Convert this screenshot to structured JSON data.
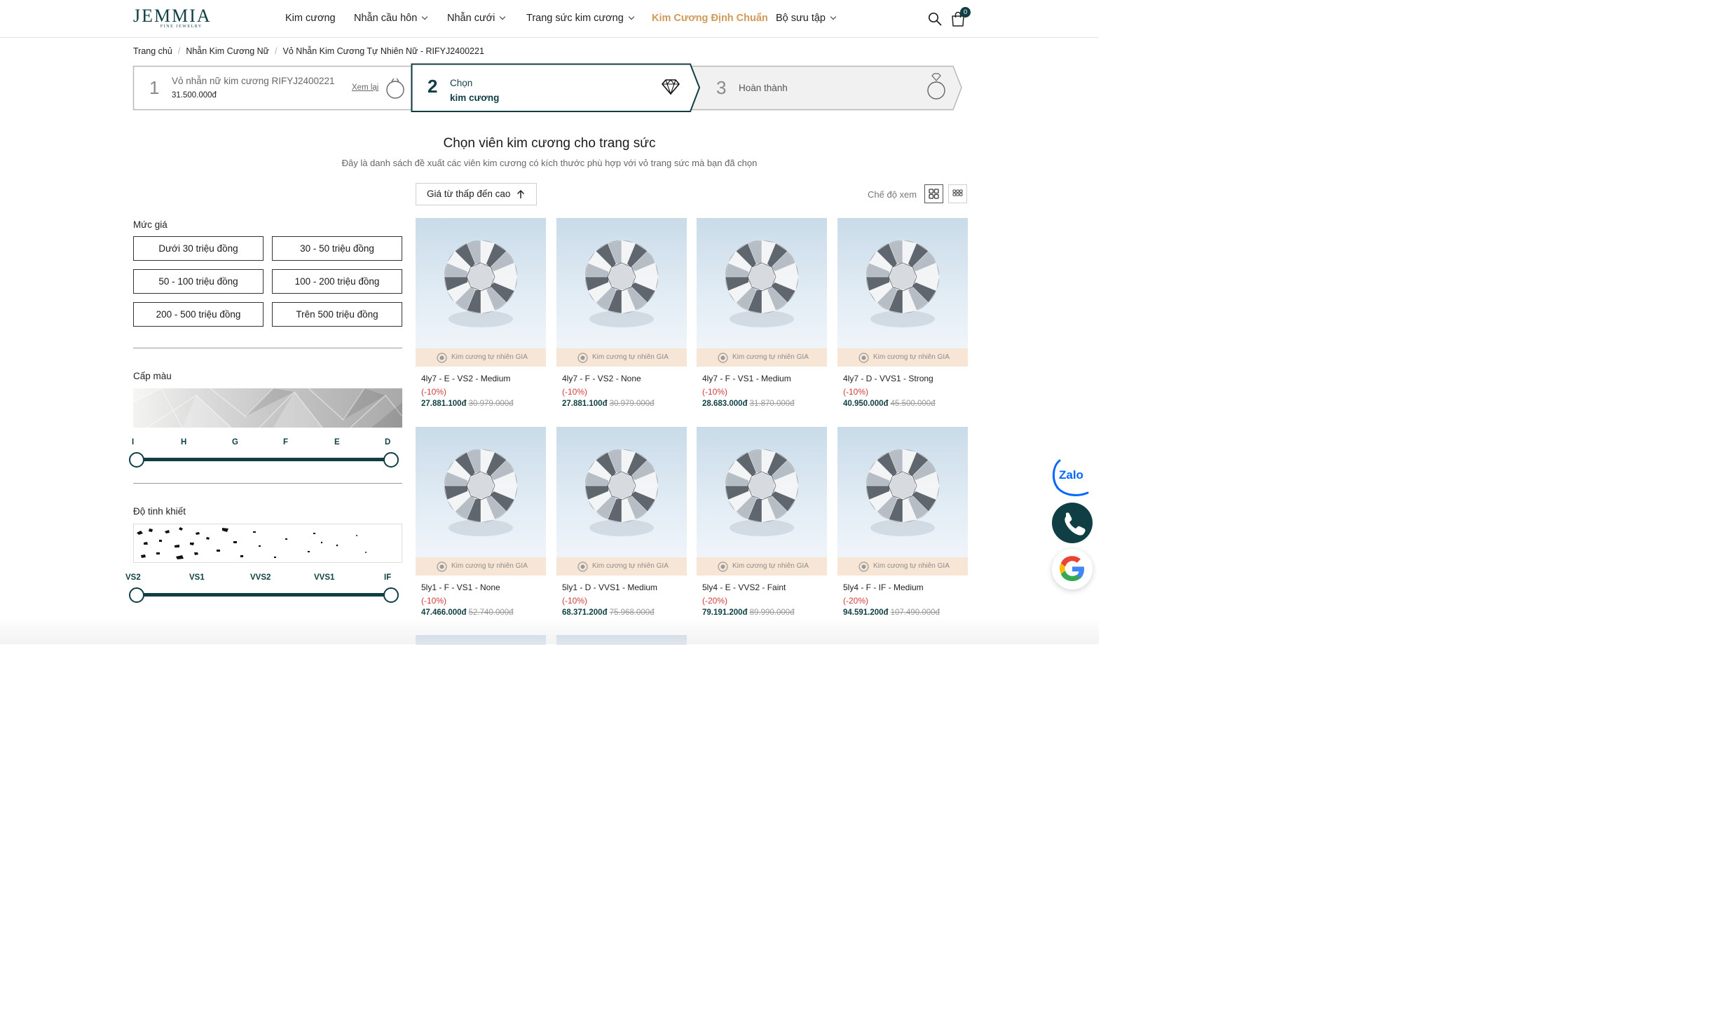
{
  "header": {
    "logo_main": "JEMMIA",
    "logo_sub": "FINE JEWELRY",
    "nav": [
      {
        "label": "Kim cương",
        "dropdown": false
      },
      {
        "label": "Nhẫn cầu hôn",
        "dropdown": true
      },
      {
        "label": "Nhẫn cưới",
        "dropdown": true
      },
      {
        "label": "Trang sức kim cương",
        "dropdown": true
      },
      {
        "label": "Kim Cương Định Chuẩn",
        "dropdown": false,
        "highlight": true
      },
      {
        "label": "Bộ sưu tập",
        "dropdown": true
      }
    ],
    "cart_count": "0",
    "accent_color": "#d09a58",
    "brand_color": "#0f3f44"
  },
  "breadcrumb": [
    "Trang chủ",
    "Nhẫn Kim Cương Nữ",
    "Vỏ Nhẫn Kim Cương Tự Nhiên Nữ - RIFYJ2400221"
  ],
  "steps": [
    {
      "number": "1",
      "title": "Vỏ nhẫn nữ kim cương RIFYJ2400221",
      "price": "31.500.000đ",
      "action": "Xem lại",
      "icon": "ring-icon"
    },
    {
      "number": "2",
      "title_line1": "Chọn",
      "title_line2": "kim cương",
      "active": true,
      "icon": "diamond-icon"
    },
    {
      "number": "3",
      "title": "Hoàn thành",
      "icon": "ring-with-diamond-icon"
    }
  ],
  "section": {
    "title": "Chọn viên kim cương cho trang sức",
    "subtitle": "Đây là danh sách đề xuất các viên kim cương có kích thước phù hợp với vỏ trang sức mà bạn đã chọn"
  },
  "sort": {
    "label": "Giá từ thấp đến cao"
  },
  "view_mode": {
    "label": "Chế độ xem"
  },
  "filters": {
    "price": {
      "title": "Mức giá",
      "options": [
        "Dưới 30 triệu đồng",
        "30 - 50 triệu đồng",
        "50 - 100 triệu đồng",
        "100 - 200 triệu đồng",
        "200 - 500 triệu đồng",
        "Trên 500 triệu đồng"
      ]
    },
    "color": {
      "title": "Cấp màu",
      "scale": [
        "I",
        "H",
        "G",
        "F",
        "E",
        "D"
      ],
      "selected_range": [
        "I",
        "D"
      ]
    },
    "clarity": {
      "title": "Độ tinh khiết",
      "scale": [
        "VS2",
        "VS1",
        "VVS2",
        "VVS1",
        "IF"
      ],
      "selected_range": [
        "VS2",
        "IF"
      ]
    }
  },
  "products": [
    {
      "badge": "Kim cương tự nhiên GIA",
      "name": "4ly7 - E - VS2 - Medium",
      "discount": "(-10%)",
      "price": "27.881.100đ",
      "old_price": "30.979.000đ"
    },
    {
      "badge": "Kim cương tự nhiên GIA",
      "name": "4ly7 - F - VS2 - None",
      "discount": "(-10%)",
      "price": "27.881.100đ",
      "old_price": "30.979.000đ"
    },
    {
      "badge": "Kim cương tự nhiên GIA",
      "name": "4ly7 - F - VS1 - Medium",
      "discount": "(-10%)",
      "price": "28.683.000đ",
      "old_price": "31.870.000đ"
    },
    {
      "badge": "Kim cương tự nhiên GIA",
      "name": "4ly7 - D - VVS1 - Strong",
      "discount": "(-10%)",
      "price": "40.950.000đ",
      "old_price": "45.500.000đ"
    },
    {
      "badge": "Kim cương tự nhiên GIA",
      "name": "5ly1 - F - VS1 - None",
      "discount": "(-10%)",
      "price": "47.466.000đ",
      "old_price": "52.740.000đ"
    },
    {
      "badge": "Kim cương tự nhiên GIA",
      "name": "5ly1 - D - VVS1 - Medium",
      "discount": "(-10%)",
      "price": "68.371.200đ",
      "old_price": "75.968.000đ"
    },
    {
      "badge": "Kim cương tự nhiên GIA",
      "name": "5ly4 - E - VVS2 - Faint",
      "discount": "(-20%)",
      "price": "79.191.200đ",
      "old_price": "89.990.000đ"
    },
    {
      "badge": "Kim cương tự nhiên GIA",
      "name": "5ly4 - F - IF - Medium",
      "discount": "(-20%)",
      "price": "94.591.200đ",
      "old_price": "107.490.000đ"
    }
  ],
  "floating": {
    "zalo_label": "Zalo",
    "phone": "phone-icon",
    "google": "google-icon"
  }
}
